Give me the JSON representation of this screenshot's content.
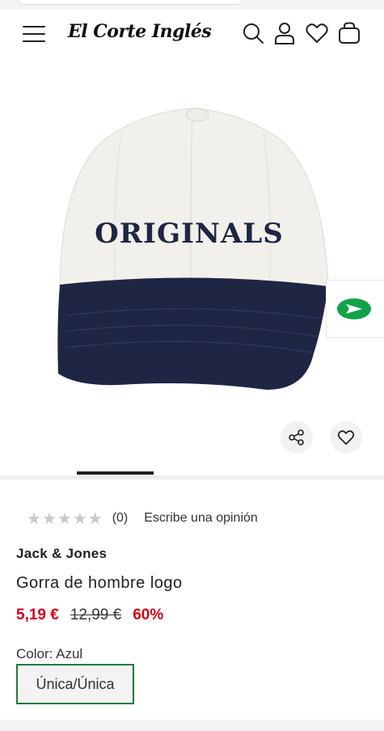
{
  "header": {
    "logo_text": "El Corte Inglés",
    "icons": [
      "menu-icon",
      "search-icon",
      "user-icon",
      "heart-icon",
      "bag-icon"
    ]
  },
  "product_image": {
    "cap_text": "ORIGINALS",
    "colors": {
      "crown": "#f2f0ea",
      "visor": "#1e2644",
      "embroidery": "#1e2644"
    }
  },
  "rating": {
    "stars_filled": 0,
    "stars_total": 5,
    "count": "(0)",
    "write_review": "Escribe una opinión"
  },
  "product": {
    "brand": "Jack & Jones",
    "title": "Gorra de hombre logo",
    "price": "5,19 €",
    "old_price": "12,99 €",
    "discount": "60%",
    "color_label": "Color: Azul",
    "size": "Única/Única"
  },
  "colors": {
    "accent_green": "#1f7a3c",
    "sale_red": "#d0021b"
  }
}
